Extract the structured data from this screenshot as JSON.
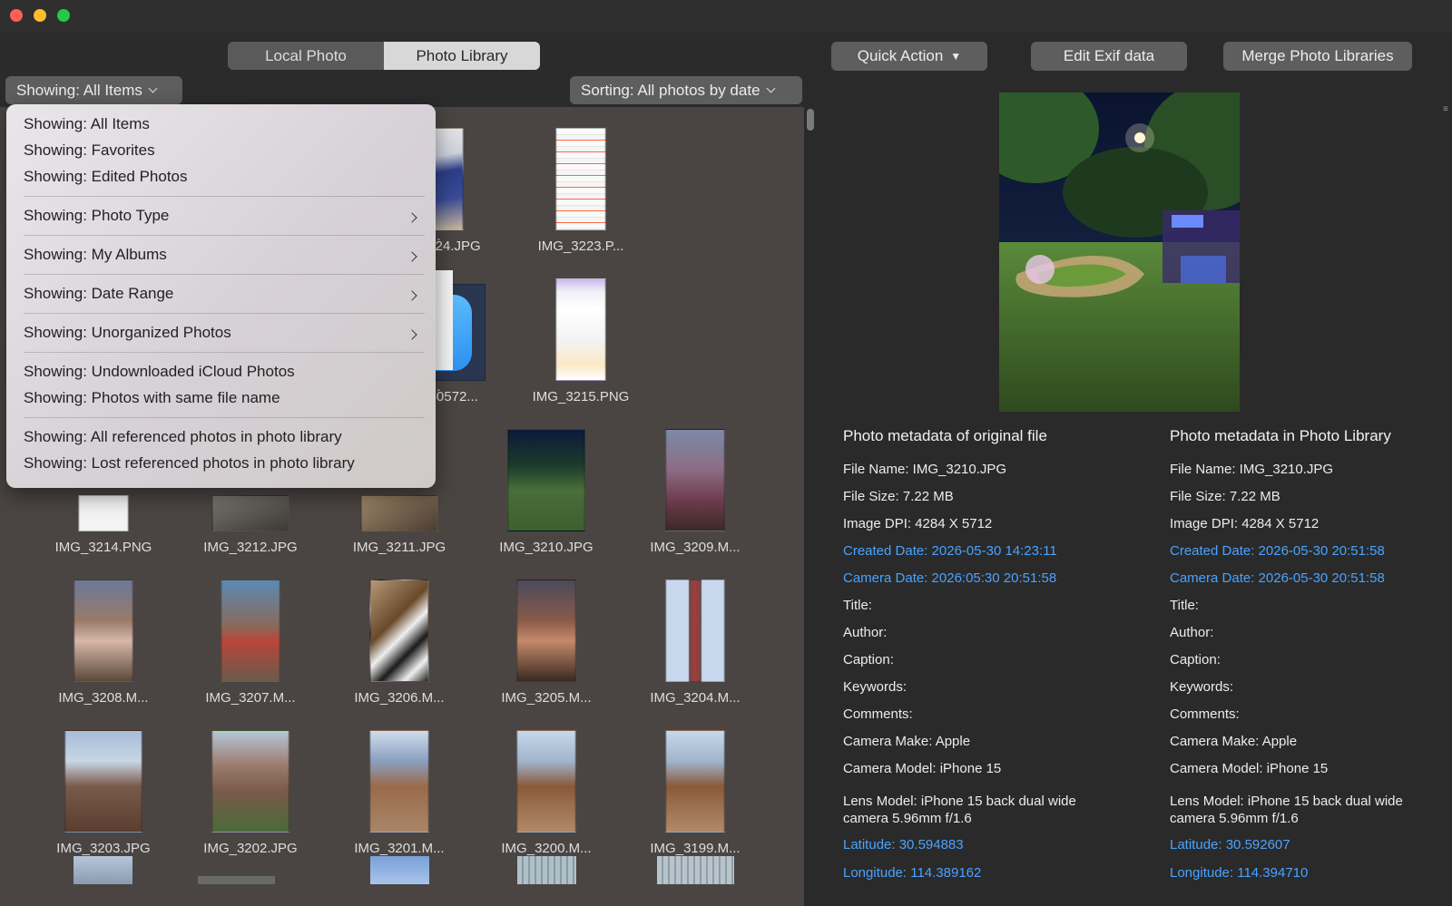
{
  "segmented": {
    "options": [
      {
        "label": "Local Photo",
        "active": false
      },
      {
        "label": "Photo Library",
        "active": true
      }
    ]
  },
  "toolbar": {
    "quick_action": "Quick Action",
    "edit_exif": "Edit Exif data",
    "merge": "Merge Photo Libraries"
  },
  "filter": {
    "label": "Showing: All Items"
  },
  "sorting": {
    "label": "Sorting: All photos by date"
  },
  "menu": {
    "items": [
      {
        "label": "Showing: All Items",
        "submenu": false
      },
      {
        "label": "Showing: Favorites",
        "submenu": false
      },
      {
        "label": "Showing: Edited Photos",
        "submenu": false
      },
      {
        "label": "Showing: Photo Type",
        "submenu": true
      },
      {
        "label": "Showing: My Albums",
        "submenu": true
      },
      {
        "label": "Showing: Date Range",
        "submenu": true
      },
      {
        "label": "Showing: Unorganized Photos",
        "submenu": true
      },
      {
        "label": "Showing: Undownloaded iCloud Photos",
        "submenu": false
      },
      {
        "label": "Showing: Photos with same file name",
        "submenu": false
      },
      {
        "label": "Showing: All referenced photos in photo library",
        "submenu": false
      },
      {
        "label": "Showing: Lost referenced photos in photo library",
        "submenu": false
      }
    ]
  },
  "grid": {
    "rows": [
      [
        "",
        "",
        "",
        "IMG_3224.JPG",
        "IMG_3223.P..."
      ],
      [
        "",
        "",
        "",
        "E672730572...",
        "IMG_3215.PNG"
      ],
      [
        "IMG_3214.PNG",
        "IMG_3212.JPG",
        "IMG_3211.JPG",
        "IMG_3210.JPG",
        "IMG_3209.M..."
      ],
      [
        "IMG_3208.M...",
        "IMG_3207.M...",
        "IMG_3206.M...",
        "IMG_3205.M...",
        "IMG_3204.M..."
      ],
      [
        "IMG_3203.JPG",
        "IMG_3202.JPG",
        "IMG_3201.M...",
        "IMG_3200.M...",
        "IMG_3199.M..."
      ],
      [
        "",
        "",
        "",
        "",
        ""
      ]
    ],
    "partial_labels": [
      "...",
      "..."
    ]
  },
  "metadata": {
    "original": {
      "heading": "Photo metadata of original file",
      "file_name": "File Name: IMG_3210.JPG",
      "file_size": "File Size: 7.22 MB",
      "dpi": "Image DPI: 4284 X 5712",
      "created": "Created Date: 2026-05-30 14:23:11",
      "camera_date": "Camera Date: 2026:05:30 20:51:58",
      "title": "Title:",
      "author": "Author:",
      "caption": "Caption:",
      "keywords": "Keywords:",
      "comments": "Comments:",
      "make": "Camera Make: Apple",
      "model": "Camera Model: iPhone 15",
      "lens": "Lens Model: iPhone 15 back dual wide camera 5.96mm f/1.6",
      "latitude": "Latitude: 30.594883",
      "longitude": "Longitude: 114.389162"
    },
    "library": {
      "heading": "Photo metadata in Photo Library",
      "file_name": "File Name: IMG_3210.JPG",
      "file_size": "File Size: 7.22 MB",
      "dpi": "Image DPI: 4284 X 5712",
      "created": "Created Date: 2026-05-30 20:51:58",
      "camera_date": "Camera Date: 2026-05-30 20:51:58",
      "title": "Title:",
      "author": "Author:",
      "caption": "Caption:",
      "keywords": "Keywords:",
      "comments": "Comments:",
      "make": "Camera Make: Apple",
      "model": "Camera Model: iPhone 15",
      "lens": "Lens Model: iPhone 15 back dual wide camera 5.96mm f/1.6",
      "latitude": "Latitude: 30.592607",
      "longitude": "Longitude: 114.394710"
    }
  },
  "colors": {
    "link": "#4aa3ff",
    "grid_bg": "#4a4543",
    "panel_bg": "#2a2a2a"
  }
}
